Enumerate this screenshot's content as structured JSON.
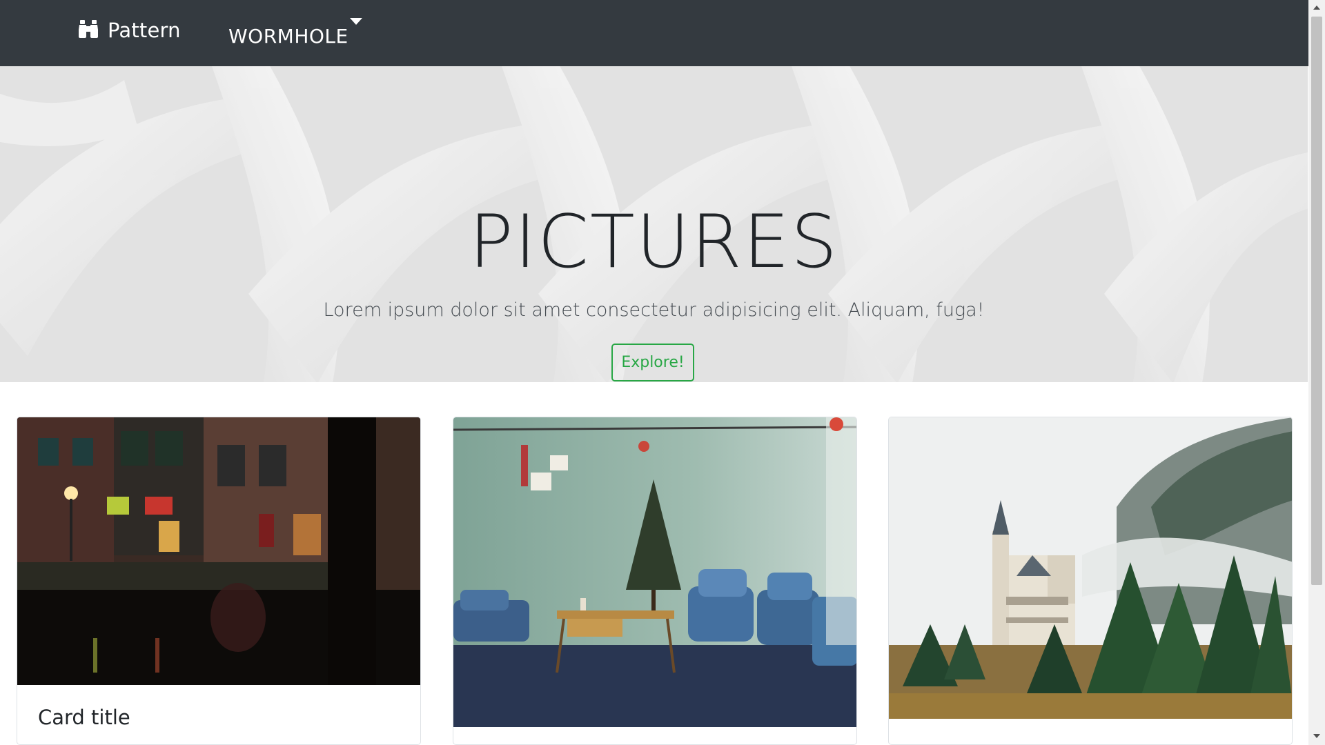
{
  "navbar": {
    "brand_label": "Pattern",
    "brand_icon": "binoculars-icon",
    "dropdown_label": "WORMHOLE"
  },
  "hero": {
    "title": "PICTURES",
    "subtitle": "Lorem ipsum dolor sit amet consectetur adipisicing elit. Aliquam, fuga!",
    "button_label": "Explore!"
  },
  "cards": [
    {
      "title": "Card title",
      "image": "night-canal-street-photo"
    },
    {
      "title": "",
      "image": "retro-living-room-christmas-tree-photo"
    },
    {
      "title": "",
      "image": "castle-in-misty-forest-photo"
    }
  ],
  "colors": {
    "navbar_bg": "#343a40",
    "accent_success": "#28a745",
    "text_dark": "#212529"
  }
}
